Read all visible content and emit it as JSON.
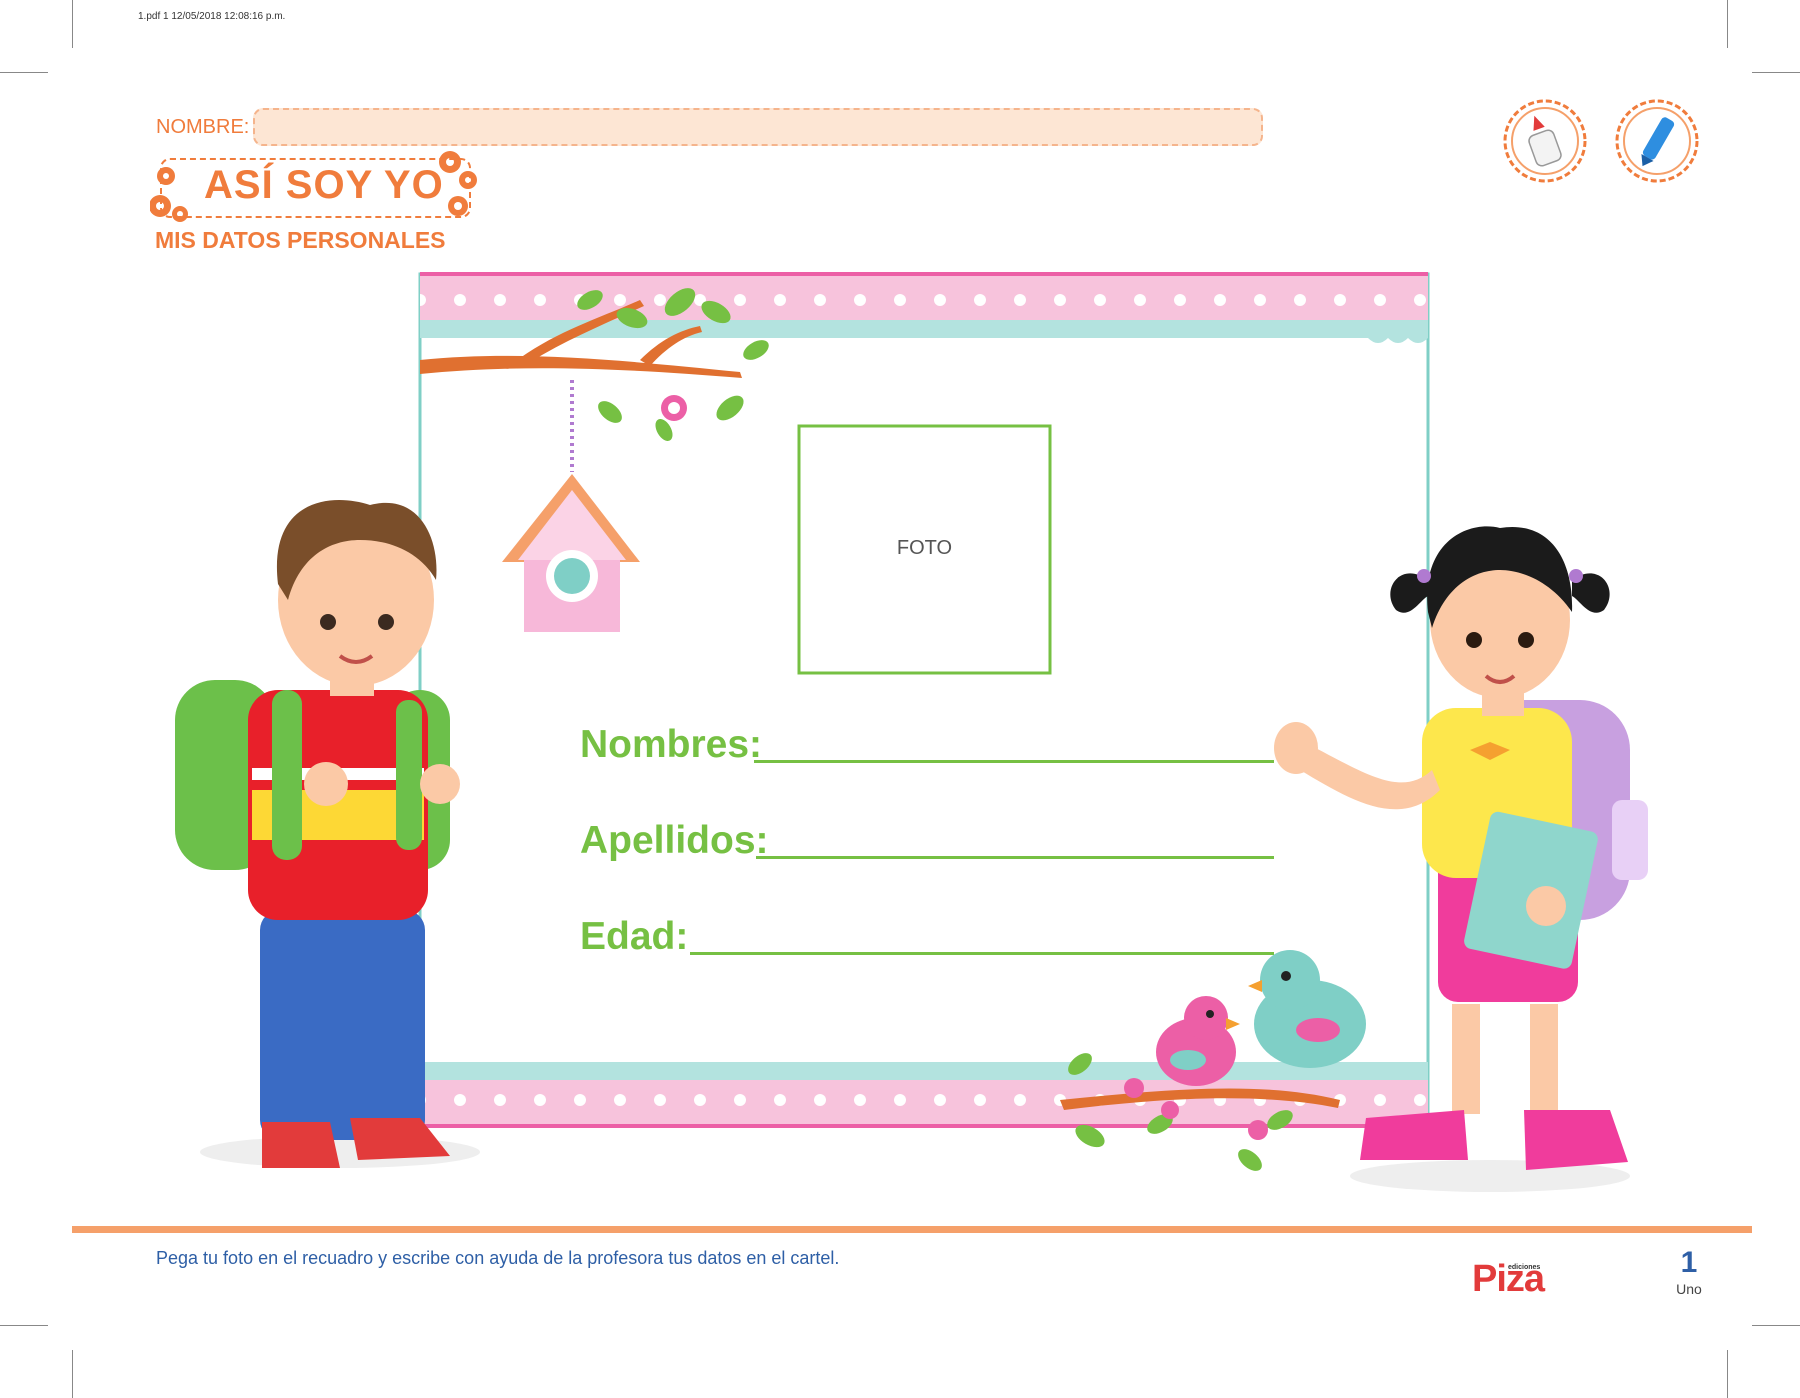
{
  "print_info": "1.pdf   1   12/05/2018   12:08:16 p.m.",
  "header": {
    "nombre_label": "NOMBRE:",
    "title": "ASÍ SOY YO",
    "subtitle": "MIS DATOS PERSONALES",
    "tools": [
      {
        "icon": "glue-bottle-icon"
      },
      {
        "icon": "marker-icon"
      }
    ]
  },
  "card": {
    "photo_label": "FOTO",
    "fields": [
      {
        "label": "Nombres:"
      },
      {
        "label": "Apellidos:"
      },
      {
        "label": "Edad:"
      }
    ]
  },
  "footer": {
    "instruction": "Pega tu foto en el recuadro y escribe con ayuda de la profesora tus datos en el cartel.",
    "brand": "Piza",
    "brand_small": "ediciones",
    "page_number": "1",
    "page_word": "Uno"
  },
  "colors": {
    "orange": "#f07c3c",
    "green": "#76c043",
    "pink": "#f7c3dc",
    "teal": "#b3e3df",
    "blue": "#2e5fa6",
    "red_brand": "#e23b3b"
  }
}
